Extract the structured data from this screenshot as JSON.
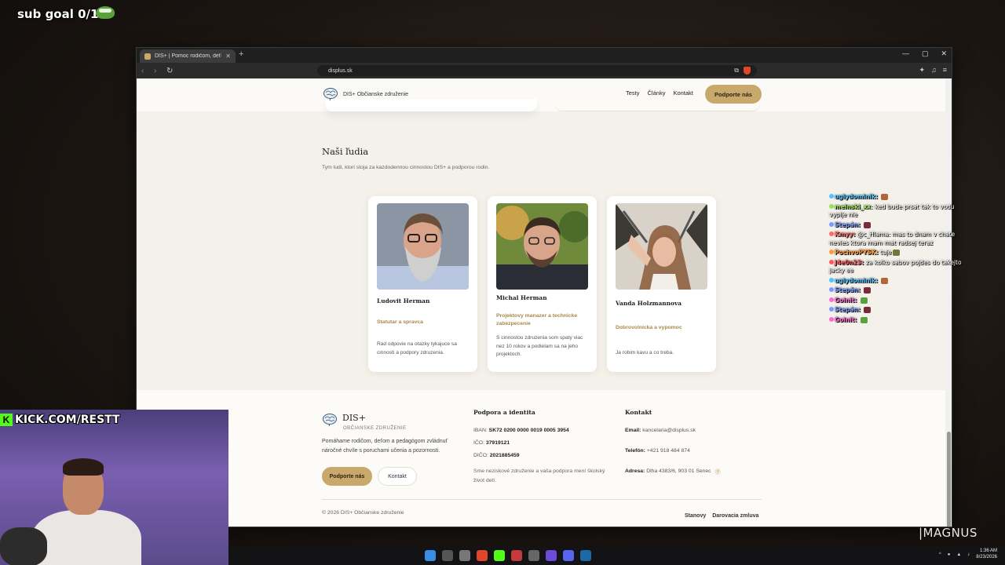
{
  "overlay": {
    "sub_goal": "sub goal 0/1",
    "kick_url": "KICK.COM/RESTT",
    "watermark": "|MAGNUS"
  },
  "browser": {
    "tab_title": "DIS+ | Pomoc rodičom, deťom a",
    "url": "displus.sk"
  },
  "site": {
    "logo_text": "DIS+ Občianske združenie",
    "nav": [
      "Testy",
      "Články",
      "Kontakt"
    ],
    "cta": "Podporte nás",
    "people_section": {
      "title": "Naši ľudia",
      "subtitle": "Tym ludi, ktori stoja za kazdodennou cinnostou DIS+ a podporou rodin.",
      "people": [
        {
          "name": "Ludovit Herman",
          "role": "Statutar a spravca",
          "desc": "Rad odpovie na otazky tykajuce sa cinnosti a podpory zdruzenia."
        },
        {
          "name": "Michal Herman",
          "role": "Projektovy manazer a technicke zabezpecenie",
          "desc": "S cinnostou zdruzenia som spaty viac nez 10 rokov a podielam sa na jeho projektoch."
        },
        {
          "name": "Vanda Holzmannova",
          "role": "Dobrovolnicka a vypomoc",
          "desc": "Ja robim kavu a co treba."
        }
      ]
    },
    "footer": {
      "brand": "DIS+",
      "brand_sub": "OBČIANSKE ZDRUŽENIE",
      "tagline": "Pomáhame rodičom, deťom a pedagógom zvládnuť náročné chvíle s poruchami učenia a pozornosti.",
      "btn_primary": "Podporte nás",
      "btn_secondary": "Kontakt",
      "support_heading": "Podpora a identita",
      "iban_label": "IBAN:",
      "iban": "SK72 0200 0000 0019 0005 3954",
      "ico_label": "IČO:",
      "ico": "37919121",
      "dic_label": "DIČO:",
      "dic": "2021885459",
      "note": "Sme neziskové združenie a vaša podpora mení školský život detí.",
      "contact_heading": "Kontakt",
      "email_label": "Email:",
      "email": "kancelaria@displus.sk",
      "phone_label": "Telefón:",
      "phone": "+421 918 484 874",
      "address_label": "Adresa:",
      "address": "Dlha 4383/6, 903 01 Senec",
      "copyright": "© 2026 DIS+ Občianske združenie",
      "legal": [
        "Stanovy",
        "Darovacia zmluva"
      ]
    }
  },
  "chat": [
    {
      "user": "uglydominik:",
      "color": "#4fc3ff",
      "text": "",
      "emote": "#b5653a"
    },
    {
      "user": "meinski_xx",
      "color": "#9be05a",
      "text": ": ked bude prsat tak to vodu vypije nie"
    },
    {
      "user": "Stepán:",
      "color": "#7a9cff",
      "text": "",
      "emote": "#7a2a3a"
    },
    {
      "user": "Kmyy:",
      "color": "#ff6b6b",
      "text": "@c_Hlama: mas to dnam v chate nevies ktora mam mat radsej teraz"
    },
    {
      "user": "PochvoPYSK:",
      "color": "#ff9a3c",
      "text": "tuje",
      "emote": "#6b7a3a"
    },
    {
      "user": "J4e0n23:",
      "color": "#ff5a5a",
      "text": "za kolko sabov pojdes do takejto jacky ee"
    },
    {
      "user": "uglydominik:",
      "color": "#4fc3ff",
      "text": "",
      "emote": "#b5653a"
    },
    {
      "user": "Stepán:",
      "color": "#7a9cff",
      "text": "",
      "emote": "#7a2a3a"
    },
    {
      "user": "Goinit:",
      "color": "#ff6bd5",
      "text": "",
      "emote": "#5aa13c"
    },
    {
      "user": "Stepán:",
      "color": "#7a9cff",
      "text": "",
      "emote": "#7a2a3a"
    },
    {
      "user": "Goinit:",
      "color": "#ff6bd5",
      "text": "",
      "emote": "#5aa13c"
    }
  ],
  "taskbar": {
    "time": "1:36 AM",
    "date": "8/23/2026"
  }
}
